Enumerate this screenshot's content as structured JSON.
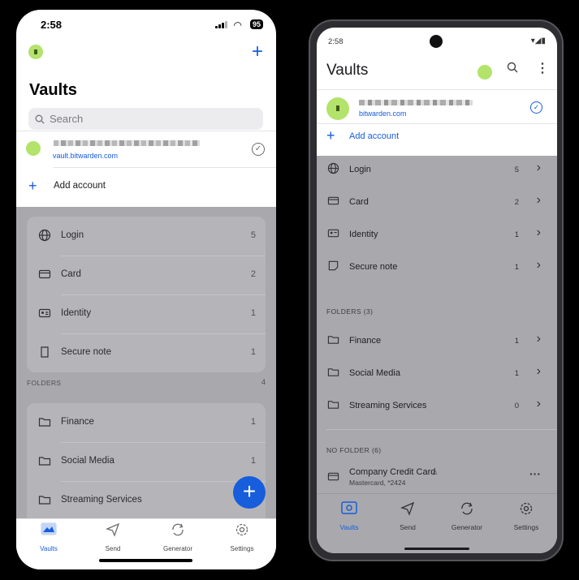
{
  "ios": {
    "time": "2:58",
    "battery": "95",
    "title": "Vaults",
    "search_placeholder": "Search",
    "account_url": "vault.bitwarden.com",
    "add_account": "Add account",
    "types": [
      {
        "label": "Login",
        "count": "5"
      },
      {
        "label": "Card",
        "count": "2"
      },
      {
        "label": "Identity",
        "count": "1"
      },
      {
        "label": "Secure note",
        "count": "1"
      }
    ],
    "folders_header": "FOLDERS",
    "folders_count": "4",
    "folders": [
      {
        "label": "Finance",
        "count": "1"
      },
      {
        "label": "Social Media",
        "count": "1"
      },
      {
        "label": "Streaming Services",
        "count": "1"
      }
    ],
    "tabs": [
      "Vaults",
      "Send",
      "Generator",
      "Settings"
    ]
  },
  "android": {
    "time": "2:58",
    "title": "Vaults",
    "account_url": "bitwarden.com",
    "add_account": "Add account",
    "types": [
      {
        "label": "Login",
        "count": "5"
      },
      {
        "label": "Card",
        "count": "2"
      },
      {
        "label": "Identity",
        "count": "1"
      },
      {
        "label": "Secure note",
        "count": "1"
      }
    ],
    "folders_header": "FOLDERS (3)",
    "folders": [
      {
        "label": "Finance",
        "count": "1"
      },
      {
        "label": "Social Media",
        "count": "1"
      },
      {
        "label": "Streaming Services",
        "count": "0"
      }
    ],
    "no_folder_header": "NO FOLDER (6)",
    "no_folder_item": {
      "label": "Company Credit Card",
      "sub": "Mastercard, *2424"
    },
    "tabs": [
      "Vaults",
      "Send",
      "Generator",
      "Settings"
    ]
  },
  "colors": {
    "accent": "#175ddc",
    "avatar": "#b3e36b",
    "scrim": "#a9a9ad"
  },
  "icons": [
    "globe-icon",
    "card-icon",
    "id-card-icon",
    "note-icon",
    "folder-icon",
    "vault-icon",
    "send-icon",
    "generator-icon",
    "settings-icon",
    "search-icon",
    "plus-icon",
    "check-circle-icon",
    "more-vert-icon",
    "chevron-right-icon"
  ]
}
